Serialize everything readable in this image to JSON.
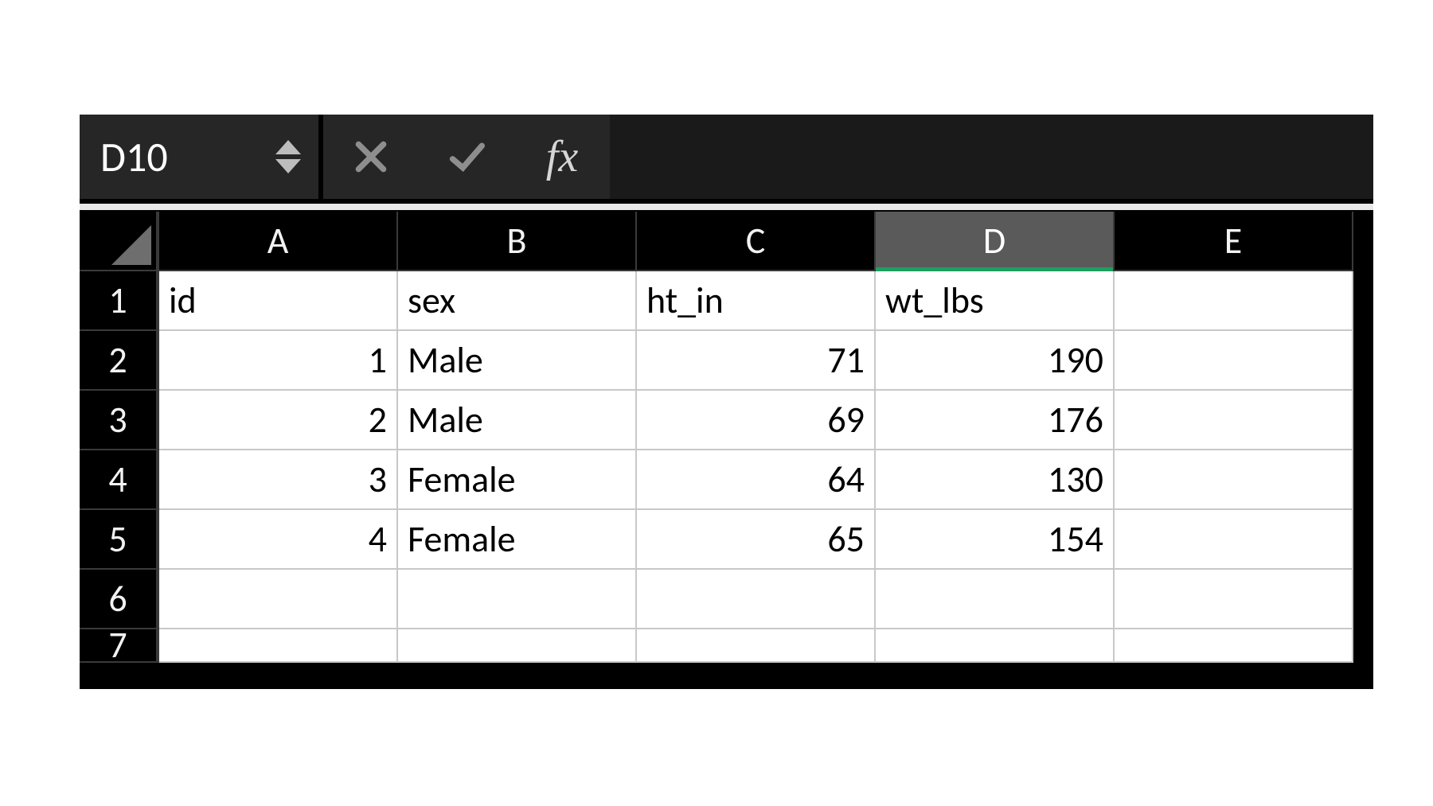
{
  "formula_bar": {
    "name_box": "D10",
    "formula_value": "",
    "fx_label": "fx"
  },
  "columns": [
    "A",
    "B",
    "C",
    "D",
    "E"
  ],
  "active_column": "D",
  "row_numbers": [
    "1",
    "2",
    "3",
    "4",
    "5",
    "6",
    "7"
  ],
  "headers": {
    "A": "id",
    "B": "sex",
    "C": "ht_in",
    "D": "wt_lbs",
    "E": ""
  },
  "rows": [
    {
      "id": "1",
      "sex": "Male",
      "ht_in": "71",
      "wt_lbs": "190"
    },
    {
      "id": "2",
      "sex": "Male",
      "ht_in": "69",
      "wt_lbs": "176"
    },
    {
      "id": "3",
      "sex": "Female",
      "ht_in": "64",
      "wt_lbs": "130"
    },
    {
      "id": "4",
      "sex": "Female",
      "ht_in": "65",
      "wt_lbs": "154"
    }
  ]
}
